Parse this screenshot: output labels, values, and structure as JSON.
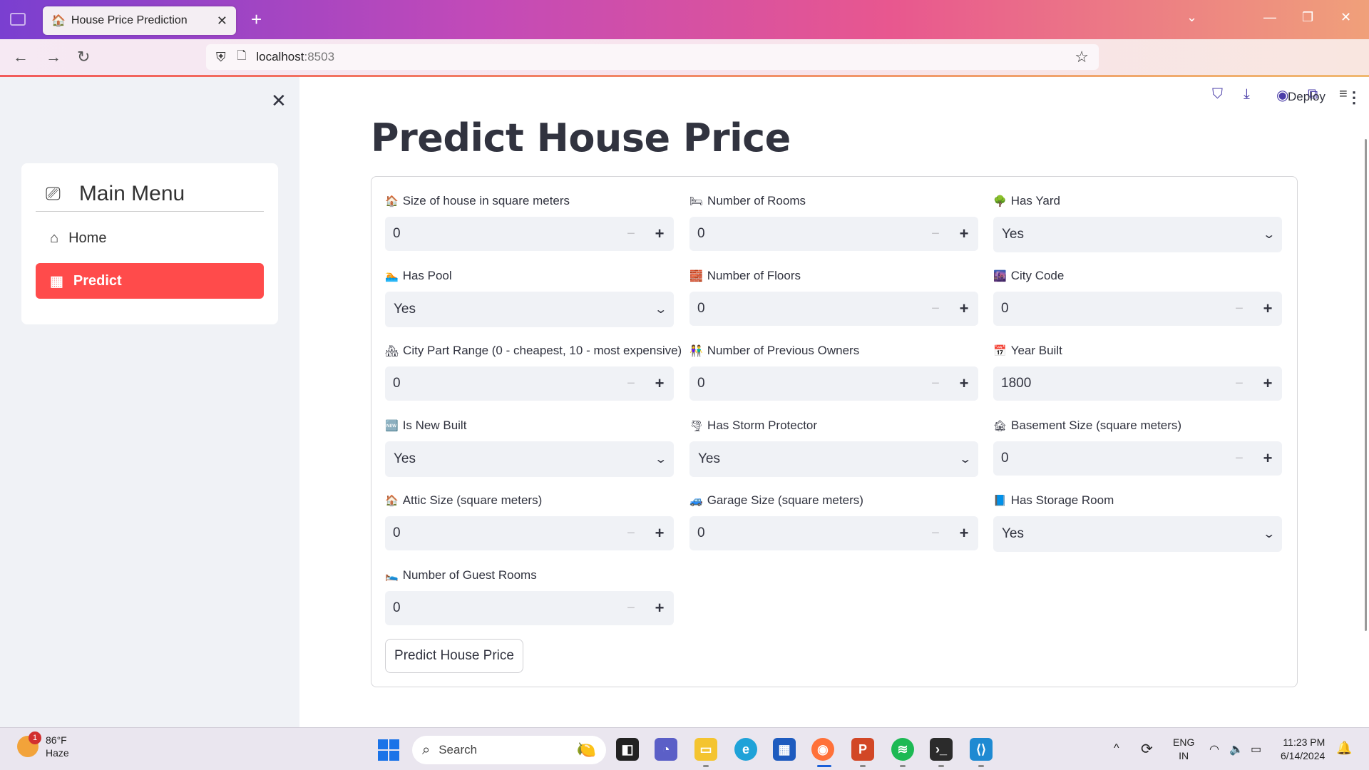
{
  "browser": {
    "tab_title": "House Price Prediction",
    "tab_favicon": "🏠",
    "url_host": "localhost",
    "url_port": ":8503"
  },
  "app": {
    "deploy_label": "Deploy",
    "title": "Predict House Price",
    "accent_color": "#ff4b4b"
  },
  "sidebar": {
    "menu_title": "Main Menu",
    "items": [
      {
        "label": "Home",
        "icon": "house-icon",
        "active": false
      },
      {
        "label": "Predict",
        "icon": "calculator-icon",
        "active": true
      }
    ]
  },
  "form": {
    "fields": [
      {
        "label": "Size of house in square meters",
        "emoji": "🏠",
        "type": "number",
        "value": "0"
      },
      {
        "label": "Number of Rooms",
        "emoji": "🛏",
        "type": "number",
        "value": "0"
      },
      {
        "label": "Has Yard",
        "emoji": "🌳",
        "type": "select",
        "value": "Yes"
      },
      {
        "label": "Has Pool",
        "emoji": "🏊",
        "type": "select",
        "value": "Yes"
      },
      {
        "label": "Number of Floors",
        "emoji": "🧱",
        "type": "number",
        "value": "0"
      },
      {
        "label": "City Code",
        "emoji": "🌆",
        "type": "number",
        "value": "0"
      },
      {
        "label": "City Part Range (0 - cheapest, 10 - most expensive)",
        "emoji": "🏘",
        "type": "number",
        "value": "0"
      },
      {
        "label": "Number of Previous Owners",
        "emoji": "👫",
        "type": "number",
        "value": "0"
      },
      {
        "label": "Year Built",
        "emoji": "📅",
        "type": "number",
        "value": "1800"
      },
      {
        "label": "Is New Built",
        "emoji": "🆕",
        "type": "select",
        "value": "Yes"
      },
      {
        "label": "Has Storm Protector",
        "emoji": "🌪",
        "type": "select",
        "value": "Yes"
      },
      {
        "label": "Basement Size (square meters)",
        "emoji": "🏚",
        "type": "number",
        "value": "0"
      },
      {
        "label": "Attic Size (square meters)",
        "emoji": "🏠",
        "type": "number",
        "value": "0"
      },
      {
        "label": "Garage Size (square meters)",
        "emoji": "🚙",
        "type": "number",
        "value": "0"
      },
      {
        "label": "Has Storage Room",
        "emoji": "📘",
        "type": "select",
        "value": "Yes"
      },
      {
        "label": "Number of Guest Rooms",
        "emoji": "🛌",
        "type": "number",
        "value": "0"
      }
    ],
    "submit_label": "Predict House Price"
  },
  "taskbar": {
    "weather_temp": "86°F",
    "weather_desc": "Haze",
    "weather_badge": "1",
    "search_placeholder": "Search",
    "lang_line1": "ENG",
    "lang_line2": "IN",
    "time": "11:23 PM",
    "date": "6/14/2024"
  }
}
